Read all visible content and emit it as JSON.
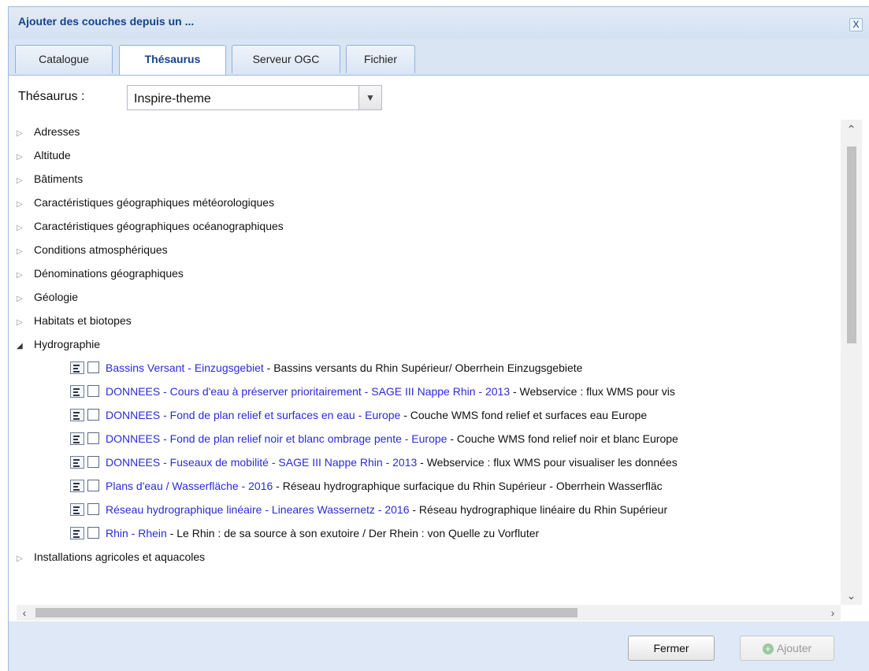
{
  "dialog": {
    "title": "Ajouter des couches depuis un ...",
    "close_label": "X"
  },
  "tabs": [
    {
      "label": "Catalogue",
      "active": false
    },
    {
      "label": "Thésaurus",
      "active": true
    },
    {
      "label": "Serveur OGC",
      "active": false
    },
    {
      "label": "Fichier",
      "active": false
    }
  ],
  "thesaurus": {
    "label": "Thésaurus :",
    "selected": "Inspire-theme"
  },
  "tree": {
    "categories_before": [
      {
        "label": "Adresses",
        "expanded": false
      },
      {
        "label": "Altitude",
        "expanded": false
      },
      {
        "label": "Bâtiments",
        "expanded": false
      },
      {
        "label": "Caractéristiques géographiques météorologiques",
        "expanded": false
      },
      {
        "label": "Caractéristiques géographiques océanographiques",
        "expanded": false
      },
      {
        "label": "Conditions atmosphériques",
        "expanded": false
      },
      {
        "label": "Dénominations géographiques",
        "expanded": false
      },
      {
        "label": "Géologie",
        "expanded": false
      },
      {
        "label": "Habitats et biotopes",
        "expanded": false
      },
      {
        "label": "Hydrographie",
        "expanded": true
      }
    ],
    "hydrographie_items": [
      {
        "title": "Bassins Versant - Einzugsgebiet",
        "desc": " - Bassins versants du Rhin Supérieur/ Oberrhein Einzugsgebiete"
      },
      {
        "title": "DONNEES - Cours d'eau à préserver prioritairement - SAGE III Nappe Rhin - 2013",
        "desc": " - Webservice : flux WMS pour vis"
      },
      {
        "title": "DONNEES - Fond de plan relief et surfaces en eau - Europe",
        "desc": " - Couche WMS fond relief et surfaces eau Europe"
      },
      {
        "title": "DONNEES - Fond de plan relief noir et blanc ombrage pente - Europe",
        "desc": " - Couche WMS fond relief noir et blanc Europe"
      },
      {
        "title": "DONNEES - Fuseaux de mobilité - SAGE III Nappe Rhin - 2013",
        "desc": " - Webservice : flux WMS pour visualiser les données"
      },
      {
        "title": "Plans d'eau / Wasserfläche - 2016",
        "desc": " - Réseau hydrographique surfacique du Rhin Supérieur - Oberrhein Wasserfläc"
      },
      {
        "title": "Réseau hydrographique linéaire - Lineares Wassernetz - 2016",
        "desc": " - Réseau hydrographique linéaire du Rhin Supérieur"
      },
      {
        "title": "Rhin - Rhein",
        "desc": " - Le Rhin : de sa source à son exutoire / Der Rhein : von Quelle zu Vorfluter"
      }
    ],
    "categories_after": [
      {
        "label": "Installations agricoles et aquacoles",
        "expanded": false
      }
    ]
  },
  "footer": {
    "close_button": "Fermer",
    "add_button": "Ajouter"
  },
  "colors": {
    "link": "#2b2bd9",
    "title": "#15428b",
    "footer_bg": "#dfe8f6"
  }
}
